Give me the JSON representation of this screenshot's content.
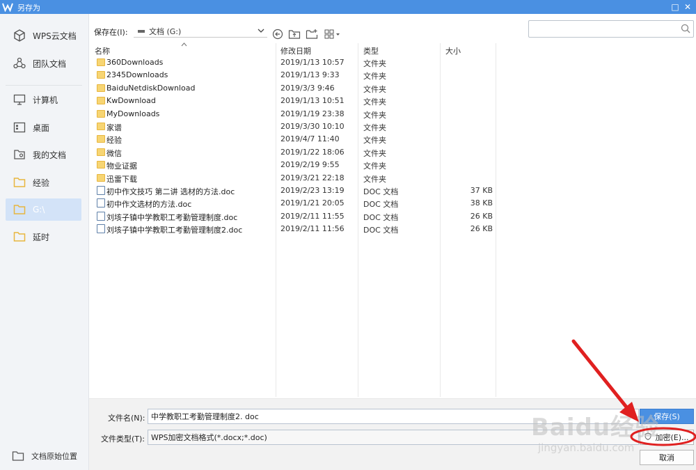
{
  "window": {
    "title": "另存为",
    "maximize_glyph": "□",
    "close_glyph": "✕"
  },
  "sidebar": {
    "items": [
      {
        "label": "WPS云文档",
        "icon": "cloud-cube-icon"
      },
      {
        "label": "团队文档",
        "icon": "team-icon"
      },
      {
        "label": "计算机",
        "icon": "monitor-icon"
      },
      {
        "label": "桌面",
        "icon": "desktop-icon"
      },
      {
        "label": "我的文档",
        "icon": "my-documents-icon"
      },
      {
        "label": "经验",
        "icon": "folder-icon"
      },
      {
        "label": "G:\\",
        "icon": "folder-icon",
        "active": true
      },
      {
        "label": "延时",
        "icon": "folder-icon"
      }
    ],
    "footer": {
      "label": "文档原始位置",
      "icon": "folder-icon"
    }
  },
  "toolbar": {
    "save_in_label": "保存在(I):",
    "location": "文档 (G:)",
    "search_placeholder": ""
  },
  "columns": {
    "name": "名称",
    "date": "修改日期",
    "type": "类型",
    "size": "大小"
  },
  "files": [
    {
      "name": "360Downloads",
      "date": "2019/1/13 10:57",
      "type": "文件夹",
      "size": "",
      "kind": "folder"
    },
    {
      "name": "2345Downloads",
      "date": "2019/1/13 9:33",
      "type": "文件夹",
      "size": "",
      "kind": "folder"
    },
    {
      "name": "BaiduNetdiskDownload",
      "date": "2019/3/3 9:46",
      "type": "文件夹",
      "size": "",
      "kind": "folder"
    },
    {
      "name": "KwDownload",
      "date": "2019/1/13 10:51",
      "type": "文件夹",
      "size": "",
      "kind": "folder"
    },
    {
      "name": "MyDownloads",
      "date": "2019/1/19 23:38",
      "type": "文件夹",
      "size": "",
      "kind": "folder"
    },
    {
      "name": "家谱",
      "date": "2019/3/30 10:10",
      "type": "文件夹",
      "size": "",
      "kind": "folder"
    },
    {
      "name": "经验",
      "date": "2019/4/7 11:40",
      "type": "文件夹",
      "size": "",
      "kind": "folder"
    },
    {
      "name": "微信",
      "date": "2019/1/22 18:06",
      "type": "文件夹",
      "size": "",
      "kind": "folder"
    },
    {
      "name": "物业证据",
      "date": "2019/2/19 9:55",
      "type": "文件夹",
      "size": "",
      "kind": "folder"
    },
    {
      "name": "迅雷下载",
      "date": "2019/3/21 22:18",
      "type": "文件夹",
      "size": "",
      "kind": "folder"
    },
    {
      "name": "初中作文技巧 第二讲 选材的方法.doc",
      "date": "2019/2/23 13:19",
      "type": "DOC 文档",
      "size": "37 KB",
      "kind": "doc"
    },
    {
      "name": "初中作文选材的方法.doc",
      "date": "2019/1/21 20:05",
      "type": "DOC 文档",
      "size": "38 KB",
      "kind": "doc"
    },
    {
      "name": "刘垓子镇中学教职工考勤管理制度.doc",
      "date": "2019/2/11 11:55",
      "type": "DOC 文档",
      "size": "26 KB",
      "kind": "doc"
    },
    {
      "name": "刘垓子镇中学教职工考勤管理制度2.doc",
      "date": "2019/2/11 11:56",
      "type": "DOC 文档",
      "size": "26 KB",
      "kind": "doc"
    }
  ],
  "bottom": {
    "filename_label": "文件名(N):",
    "filename_value": "中学教职工考勤管理制度2. doc",
    "filetype_label": "文件类型(T):",
    "filetype_value": "WPS加密文档格式(*.docx;*.doc)",
    "save_button": "保存(S)",
    "encrypt_button": "加密(E)...",
    "cancel_button": "取消"
  },
  "watermark": {
    "logo_text": "Baidu经验",
    "url": "jingyan.baidu.com"
  },
  "colors": {
    "accent": "#4a90e2",
    "annotation": "#e02020",
    "folder": "#f7d573",
    "sidebar_bg": "#f2f4f7"
  }
}
